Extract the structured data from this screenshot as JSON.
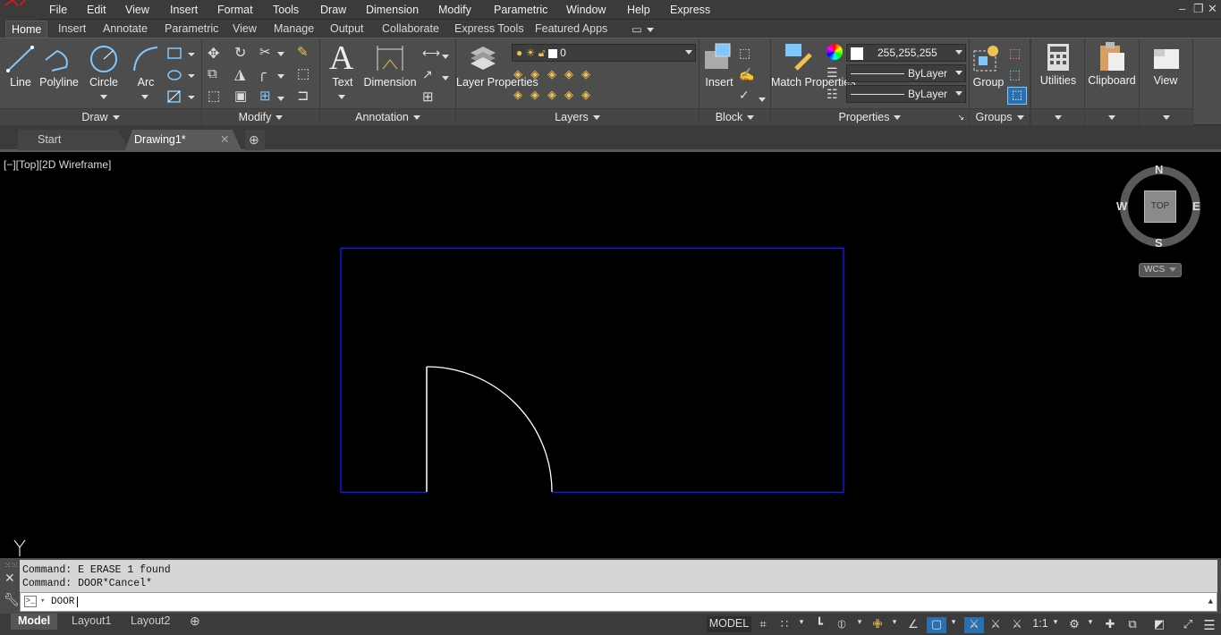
{
  "menubar": {
    "items": [
      "File",
      "Edit",
      "View",
      "Insert",
      "Format",
      "Tools",
      "Draw",
      "Dimension",
      "Modify",
      "Parametric",
      "Window",
      "Help",
      "Express"
    ]
  },
  "ribbon_tabs": [
    "Home",
    "Insert",
    "Annotate",
    "Parametric",
    "View",
    "Manage",
    "Output",
    "Collaborate",
    "Express Tools",
    "Featured Apps"
  ],
  "active_tab": "Home",
  "panels": {
    "draw": {
      "title": "Draw",
      "buttons": [
        "Line",
        "Polyline",
        "Circle",
        "Arc"
      ]
    },
    "modify": {
      "title": "Modify"
    },
    "annotation": {
      "title": "Annotation",
      "buttons": [
        "Text",
        "Dimension"
      ]
    },
    "layers": {
      "title": "Layers",
      "layer_properties": "Layer Properties",
      "current_layer": "0"
    },
    "block": {
      "title": "Block",
      "insert": "Insert"
    },
    "properties": {
      "title": "Properties",
      "match": "Match Properties",
      "color": "255,255,255",
      "linetype": "ByLayer",
      "lineweight": "ByLayer"
    },
    "groups": {
      "title": "Groups",
      "group": "Group"
    },
    "utilities": {
      "label": "Utilities"
    },
    "clipboard": {
      "label": "Clipboard"
    },
    "view": {
      "label": "View"
    }
  },
  "file_tabs": [
    "Start",
    "Drawing1*"
  ],
  "viewport": {
    "label": "[−][Top][2D Wireframe]",
    "compass": {
      "n": "N",
      "s": "S",
      "e": "E",
      "w": "W",
      "cube": "TOP",
      "ucs": "WCS"
    }
  },
  "command": {
    "history": [
      "Command: E ERASE 1 found",
      "Command: DOOR*Cancel*"
    ],
    "input": "DOOR"
  },
  "layout_tabs": [
    "Model",
    "Layout1",
    "Layout2"
  ],
  "status": {
    "model": "MODEL",
    "scale": "1:1"
  },
  "colors": {
    "accent": "#0000ff",
    "drawing": "#ffffff",
    "ribbon": "#4d4d4d"
  }
}
